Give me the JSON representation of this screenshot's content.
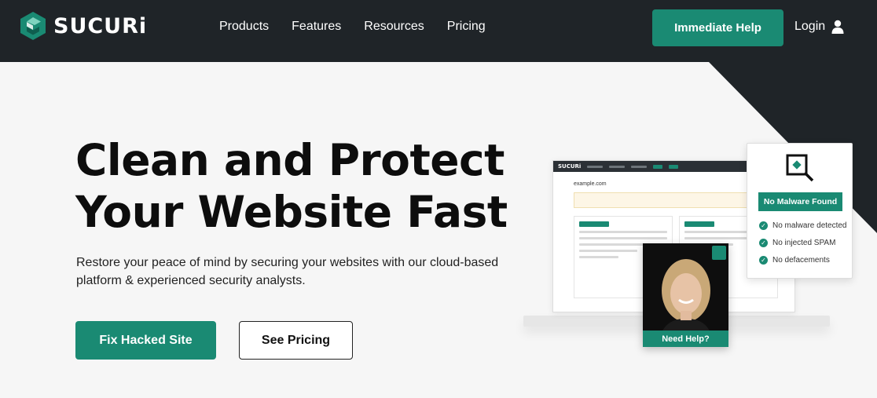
{
  "brand": {
    "name": "SUCURi"
  },
  "nav": {
    "items": [
      {
        "label": "Products"
      },
      {
        "label": "Features"
      },
      {
        "label": "Resources"
      },
      {
        "label": "Pricing"
      }
    ]
  },
  "header": {
    "cta_label": "Immediate Help",
    "login_label": "Login"
  },
  "hero": {
    "title_line1": "Clean and Protect",
    "title_line2": "Your Website Fast",
    "subtitle": "Restore your peace of mind by securing your websites with our cloud-based platform & experienced security analysts.",
    "primary_button": "Fix Hacked Site",
    "secondary_button": "See Pricing"
  },
  "mockup": {
    "screen_domain": "example.com",
    "malware_badge": "No Malware Found",
    "checks": [
      {
        "label": "No malware detected"
      },
      {
        "label": "No injected SPAM"
      },
      {
        "label": "No defacements"
      }
    ],
    "help_label": "Need Help?"
  },
  "colors": {
    "accent": "#1a8a73",
    "header_bg": "#1f2428",
    "hero_bg": "#f6f6f6"
  }
}
